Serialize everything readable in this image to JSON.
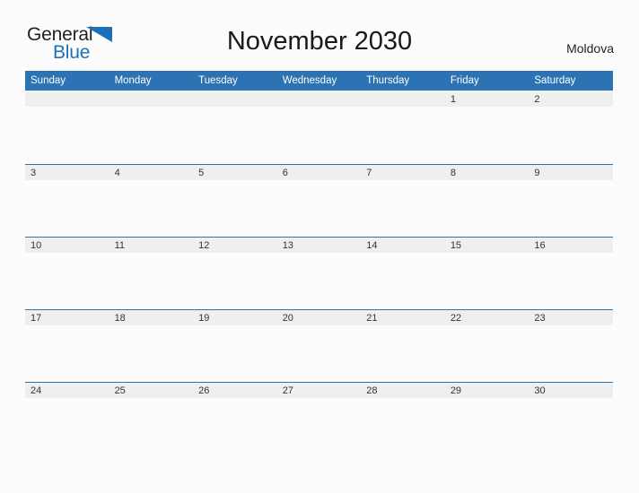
{
  "brand": {
    "name_part1": "General",
    "name_part2": "Blue",
    "flag_icon": "blue-flag-triangle-icon",
    "color_dark": "#231f20",
    "color_blue": "#1d70b8"
  },
  "header": {
    "title": "November 2030",
    "region": "Moldova"
  },
  "theme": {
    "header_bg": "#2b73b3",
    "header_text": "#ffffff",
    "day_band_bg": "#efefef",
    "day_band_border": "#2b73b3",
    "page_bg": "#fcfcfc",
    "date_text": "#333333"
  },
  "calendar": {
    "month": "November",
    "year": "2030",
    "weekday_headers": [
      "Sunday",
      "Monday",
      "Tuesday",
      "Wednesday",
      "Thursday",
      "Friday",
      "Saturday"
    ],
    "weeks": [
      {
        "days": [
          {
            "label": "",
            "blank": true
          },
          {
            "label": "",
            "blank": true
          },
          {
            "label": "",
            "blank": true
          },
          {
            "label": "",
            "blank": true
          },
          {
            "label": "",
            "blank": true
          },
          {
            "label": "1",
            "blank": false
          },
          {
            "label": "2",
            "blank": false
          }
        ]
      },
      {
        "days": [
          {
            "label": "3",
            "blank": false
          },
          {
            "label": "4",
            "blank": false
          },
          {
            "label": "5",
            "blank": false
          },
          {
            "label": "6",
            "blank": false
          },
          {
            "label": "7",
            "blank": false
          },
          {
            "label": "8",
            "blank": false
          },
          {
            "label": "9",
            "blank": false
          }
        ]
      },
      {
        "days": [
          {
            "label": "10",
            "blank": false
          },
          {
            "label": "11",
            "blank": false
          },
          {
            "label": "12",
            "blank": false
          },
          {
            "label": "13",
            "blank": false
          },
          {
            "label": "14",
            "blank": false
          },
          {
            "label": "15",
            "blank": false
          },
          {
            "label": "16",
            "blank": false
          }
        ]
      },
      {
        "days": [
          {
            "label": "17",
            "blank": false
          },
          {
            "label": "18",
            "blank": false
          },
          {
            "label": "19",
            "blank": false
          },
          {
            "label": "20",
            "blank": false
          },
          {
            "label": "21",
            "blank": false
          },
          {
            "label": "22",
            "blank": false
          },
          {
            "label": "23",
            "blank": false
          }
        ]
      },
      {
        "days": [
          {
            "label": "24",
            "blank": false
          },
          {
            "label": "25",
            "blank": false
          },
          {
            "label": "26",
            "blank": false
          },
          {
            "label": "27",
            "blank": false
          },
          {
            "label": "28",
            "blank": false
          },
          {
            "label": "29",
            "blank": false
          },
          {
            "label": "30",
            "blank": false
          }
        ]
      }
    ]
  }
}
